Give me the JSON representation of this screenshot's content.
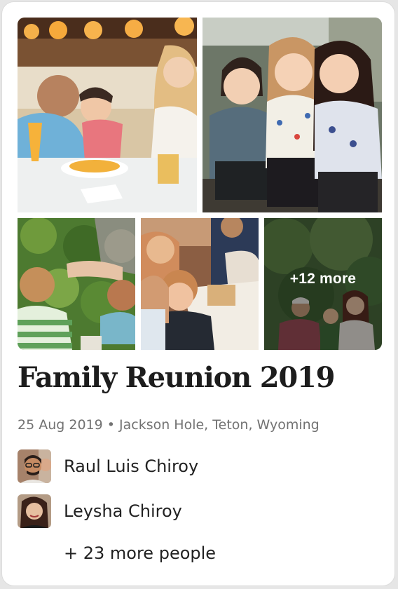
{
  "album": {
    "title": "Family Reunion 2019",
    "date": "25 Aug 2019",
    "separator": "•",
    "location": "Jackson Hole, Teton, Wyoming",
    "meta_line": "25 Aug 2019 • Jackson Hole, Teton, Wyoming",
    "more_photos_label": "+12 more"
  },
  "photos": [
    {
      "name": "photo-family-dinner"
    },
    {
      "name": "photo-three-girls"
    },
    {
      "name": "photo-kids-garden"
    },
    {
      "name": "photo-kids-table"
    },
    {
      "name": "photo-family-outdoors"
    }
  ],
  "people": [
    {
      "name": "Raul Luis Chiroy"
    },
    {
      "name": "Leysha Chiroy"
    }
  ],
  "more_people_label": "+ 23 more people",
  "colors": {
    "card_bg": "#ffffff",
    "title": "#1d1d1d",
    "meta": "#727272",
    "text": "#222222"
  }
}
